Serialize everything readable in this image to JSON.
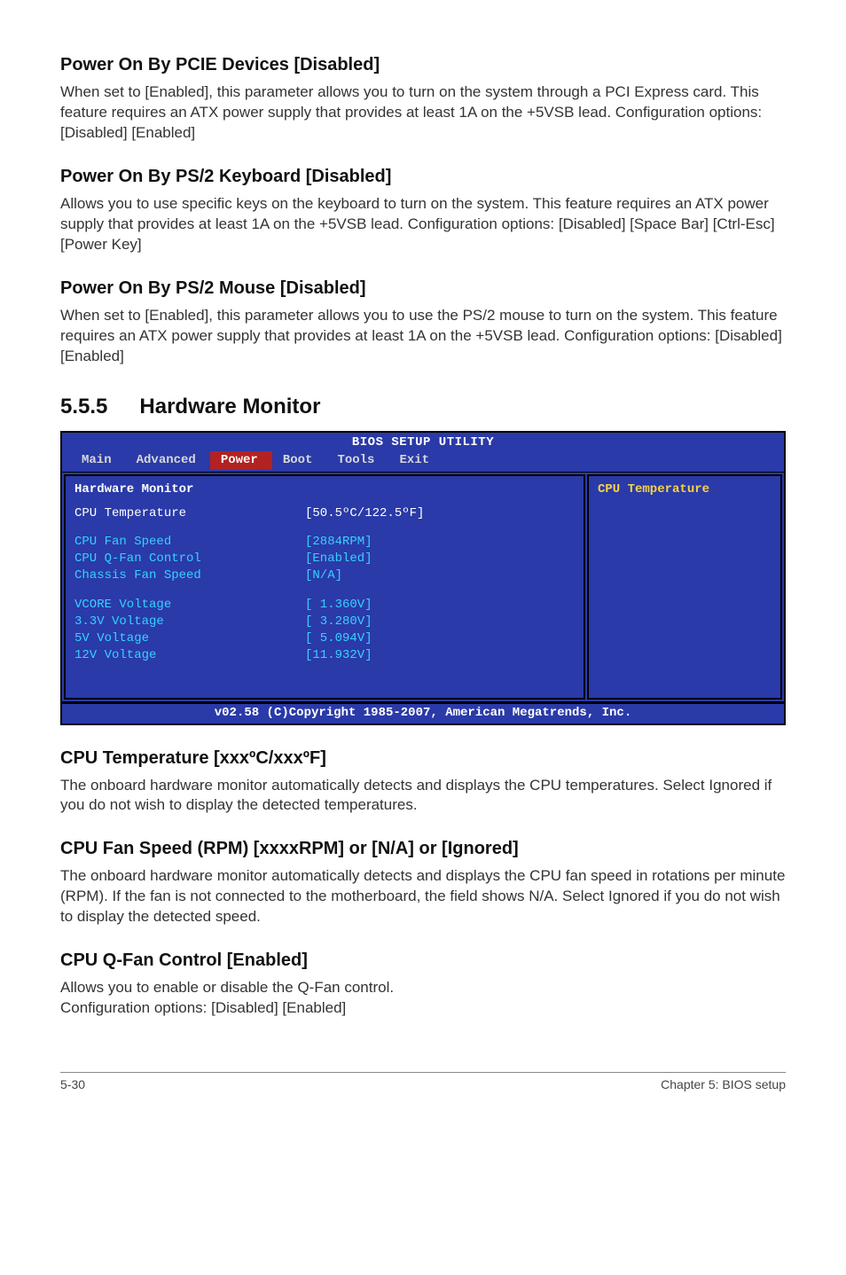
{
  "sections": [
    {
      "heading": "Power On By PCIE Devices [Disabled]",
      "body": "When set to [Enabled], this parameter allows you to turn on the system through a PCI Express card. This feature requires an ATX power supply that provides at least 1A on the +5VSB lead.  Configuration options: [Disabled] [Enabled]"
    },
    {
      "heading": "Power On By PS/2 Keyboard [Disabled]",
      "body": "Allows you to use specific keys on the keyboard to turn on the system. This feature requires an ATX power supply that provides at least 1A on the +5VSB lead. Configuration options: [Disabled] [Space Bar] [Ctrl-Esc] [Power Key]"
    },
    {
      "heading": "Power On By PS/2 Mouse [Disabled]",
      "body": "When set to [Enabled], this parameter allows you to use the PS/2 mouse to turn on the system. This feature requires an ATX power supply that provides at least 1A on the +5VSB lead. Configuration options: [Disabled] [Enabled]"
    }
  ],
  "hw": {
    "num": "5.5.5",
    "title": "Hardware Monitor"
  },
  "bios": {
    "title": "BIOS SETUP UTILITY",
    "tabs": [
      "Main",
      "Advanced",
      "Power",
      "Boot",
      "Tools",
      "Exit"
    ],
    "active_tab": "Power",
    "panel_title": "Hardware Monitor",
    "help": "CPU Temperature",
    "rows": [
      {
        "label": "CPU Temperature",
        "value": "[50.5ºC/122.5ºF]",
        "selected": true
      },
      {
        "spacer": true
      },
      {
        "label": "CPU Fan Speed",
        "value": "[2884RPM]"
      },
      {
        "label": "CPU Q-Fan Control",
        "value": "[Enabled]"
      },
      {
        "label": "Chassis Fan Speed",
        "value": "[N/A]"
      },
      {
        "spacer": true
      },
      {
        "label": "VCORE Voltage",
        "value": "[ 1.360V]"
      },
      {
        "label": "3.3V Voltage",
        "value": "[ 3.280V]"
      },
      {
        "label": "5V Voltage",
        "value": "[ 5.094V]"
      },
      {
        "label": "12V Voltage",
        "value": "[11.932V]"
      }
    ],
    "footer": "v02.58 (C)Copyright 1985-2007, American Megatrends, Inc."
  },
  "post": [
    {
      "heading": "CPU Temperature [xxxºC/xxxºF]",
      "body": "The onboard hardware monitor automatically detects and displays the CPU temperatures. Select Ignored if you do not wish to display the detected temperatures."
    },
    {
      "heading": "CPU Fan Speed (RPM) [xxxxRPM] or [N/A] or [Ignored]",
      "body": "The onboard hardware monitor automatically detects and displays the CPU fan speed in rotations per minute (RPM). If the fan is not connected to the motherboard, the field shows N/A. Select Ignored if you do not wish to display the detected speed."
    },
    {
      "heading": "CPU Q-Fan Control [Enabled]",
      "body": "Allows you to enable or disable the Q-Fan control.\nConfiguration options: [Disabled] [Enabled]"
    }
  ],
  "footer": {
    "left": "5-30",
    "right": "Chapter 5: BIOS setup"
  }
}
